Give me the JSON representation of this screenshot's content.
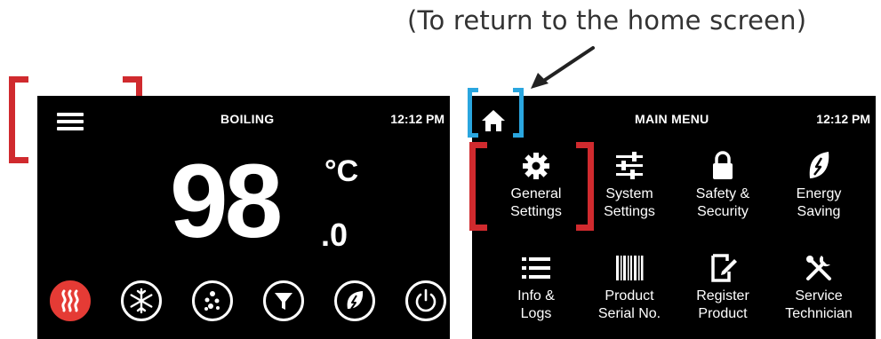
{
  "annotation": {
    "text": "(To return to the home screen)"
  },
  "left_screen": {
    "title": "BOILING",
    "time": "12:12 PM",
    "temperature": {
      "main": "98",
      "unit": "°C",
      "decimal": ".0"
    },
    "modes": [
      {
        "icon": "heat-icon",
        "active": true
      },
      {
        "icon": "snowflake-icon",
        "active": false
      },
      {
        "icon": "bubbles-icon",
        "active": false
      },
      {
        "icon": "filter-icon",
        "active": false
      },
      {
        "icon": "leaf-icon",
        "active": false
      },
      {
        "icon": "power-icon",
        "active": false
      }
    ]
  },
  "right_screen": {
    "title": "MAIN MENU",
    "time": "12:12 PM",
    "menu": [
      {
        "line1": "General",
        "line2": "Settings",
        "icon": "gear-icon"
      },
      {
        "line1": "System",
        "line2": "Settings",
        "icon": "sliders-icon"
      },
      {
        "line1": "Safety &",
        "line2": "Security",
        "icon": "lock-icon"
      },
      {
        "line1": "Energy",
        "line2": "Saving",
        "icon": "leaf-icon"
      },
      {
        "line1": "Info &",
        "line2": "Logs",
        "icon": "list-icon"
      },
      {
        "line1": "Product",
        "line2": "Serial No.",
        "icon": "barcode-icon"
      },
      {
        "line1": "Register",
        "line2": "Product",
        "icon": "register-icon"
      },
      {
        "line1": "Service",
        "line2": "Technician",
        "icon": "tools-icon"
      }
    ]
  },
  "colors": {
    "highlight_red": "#d02a2e",
    "highlight_blue": "#2aa6df",
    "active_mode": "#e53b35",
    "screen_bg": "#000000"
  }
}
